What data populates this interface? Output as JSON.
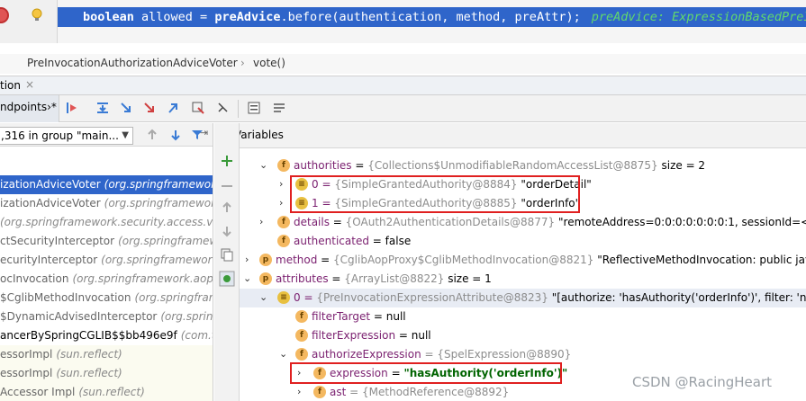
{
  "code": {
    "keyword": "boolean",
    "text": " allowed = ",
    "method_obj": "preAdvice",
    "rest": ".before(authentication, method, preAttr);",
    "hint": "preAdvice: ExpressionBasedPreInv"
  },
  "breadcrumb": {
    "class_name": "PreInvocationAuthorizationAdviceVoter",
    "separator": "›",
    "method": "vote()"
  },
  "panel": {
    "title": "tion",
    "close": "×"
  },
  "toolbar": {
    "tab_label": "ndpoints",
    "tab_suffix": "›*"
  },
  "frames": {
    "thread_selector": ",316 in group \"main...",
    "items": [
      {
        "method": "izationAdviceVoter",
        "pkg": "(org.springframework"
      },
      {
        "method": "izationAdviceVoter",
        "pkg": "(org.springframework"
      },
      {
        "method": "",
        "pkg": "(org.springframework.security.access.vote"
      },
      {
        "method": "ctSecurityInterceptor",
        "pkg": "(org.springframew"
      },
      {
        "method": "ecurityInterceptor",
        "pkg": "(org.springframework.security.a"
      },
      {
        "method": "ocInvocation",
        "pkg": "(org.springframework.aop.fr"
      },
      {
        "method": "$CglibMethodInvocation",
        "pkg": "(org.springframew"
      },
      {
        "method": "$DynamicAdvisedInterceptor",
        "pkg": "(org.spring"
      },
      {
        "method": "ancerBySpringCGLIB$$bb496e9f",
        "pkg": "(com.tac"
      },
      {
        "method": "essorImpl",
        "pkg": "(sun.reflect)"
      },
      {
        "method": "essorImpl",
        "pkg": "(sun.reflect)"
      },
      {
        "method": "Accessor Impl",
        "pkg": "(sun.reflect)"
      }
    ]
  },
  "variables": {
    "header": "Variables",
    "rows": [
      {
        "name": "authorities",
        "type": "{Collections$UnmodifiableRandomAccessList@8875}",
        "value": "size = 2"
      },
      {
        "name": "0 =",
        "type": "{SimpleGrantedAuthority@8884}",
        "value": "\"orderDetail\""
      },
      {
        "name": "1 =",
        "type": "{SimpleGrantedAuthority@8885}",
        "value": "\"orderInfo\""
      },
      {
        "name": "details",
        "type": "{OAuth2AuthenticationDetails@8877}",
        "value": "\"remoteAddress=0:0:0:0:0:0:0:1, sessionId=<SESSIO"
      },
      {
        "name": "authenticated",
        "type": "",
        "value": "= false"
      },
      {
        "name": "method",
        "type": "{CglibAopProxy$CglibMethodInvocation@8821}",
        "value": "\"ReflectiveMethodInvocation: public java.la"
      },
      {
        "name": "attributes",
        "type": "{ArrayList@8822}",
        "value": "size = 1"
      },
      {
        "name": "0 =",
        "type": "{PreInvocationExpressionAttribute@8823}",
        "value": "\"[authorize: 'hasAuthority('orderInfo')', filter: 'null', filt"
      },
      {
        "name": "filterTarget",
        "type": "",
        "value": "= null"
      },
      {
        "name": "filterExpression",
        "type": "",
        "value": "= null"
      },
      {
        "name": "authorizeExpression",
        "type": "= {SpelExpression@8890}",
        "value": ""
      },
      {
        "name": "expression",
        "type": "=",
        "value": "\"hasAuthority('orderInfo')\""
      },
      {
        "name": "ast",
        "type": "= {MethodReference@8892}",
        "value": ""
      }
    ]
  },
  "watermark": "CSDN @RacingHeart",
  "colors": {
    "selection": "#2f65ca",
    "highlight_box": "#e02020"
  }
}
